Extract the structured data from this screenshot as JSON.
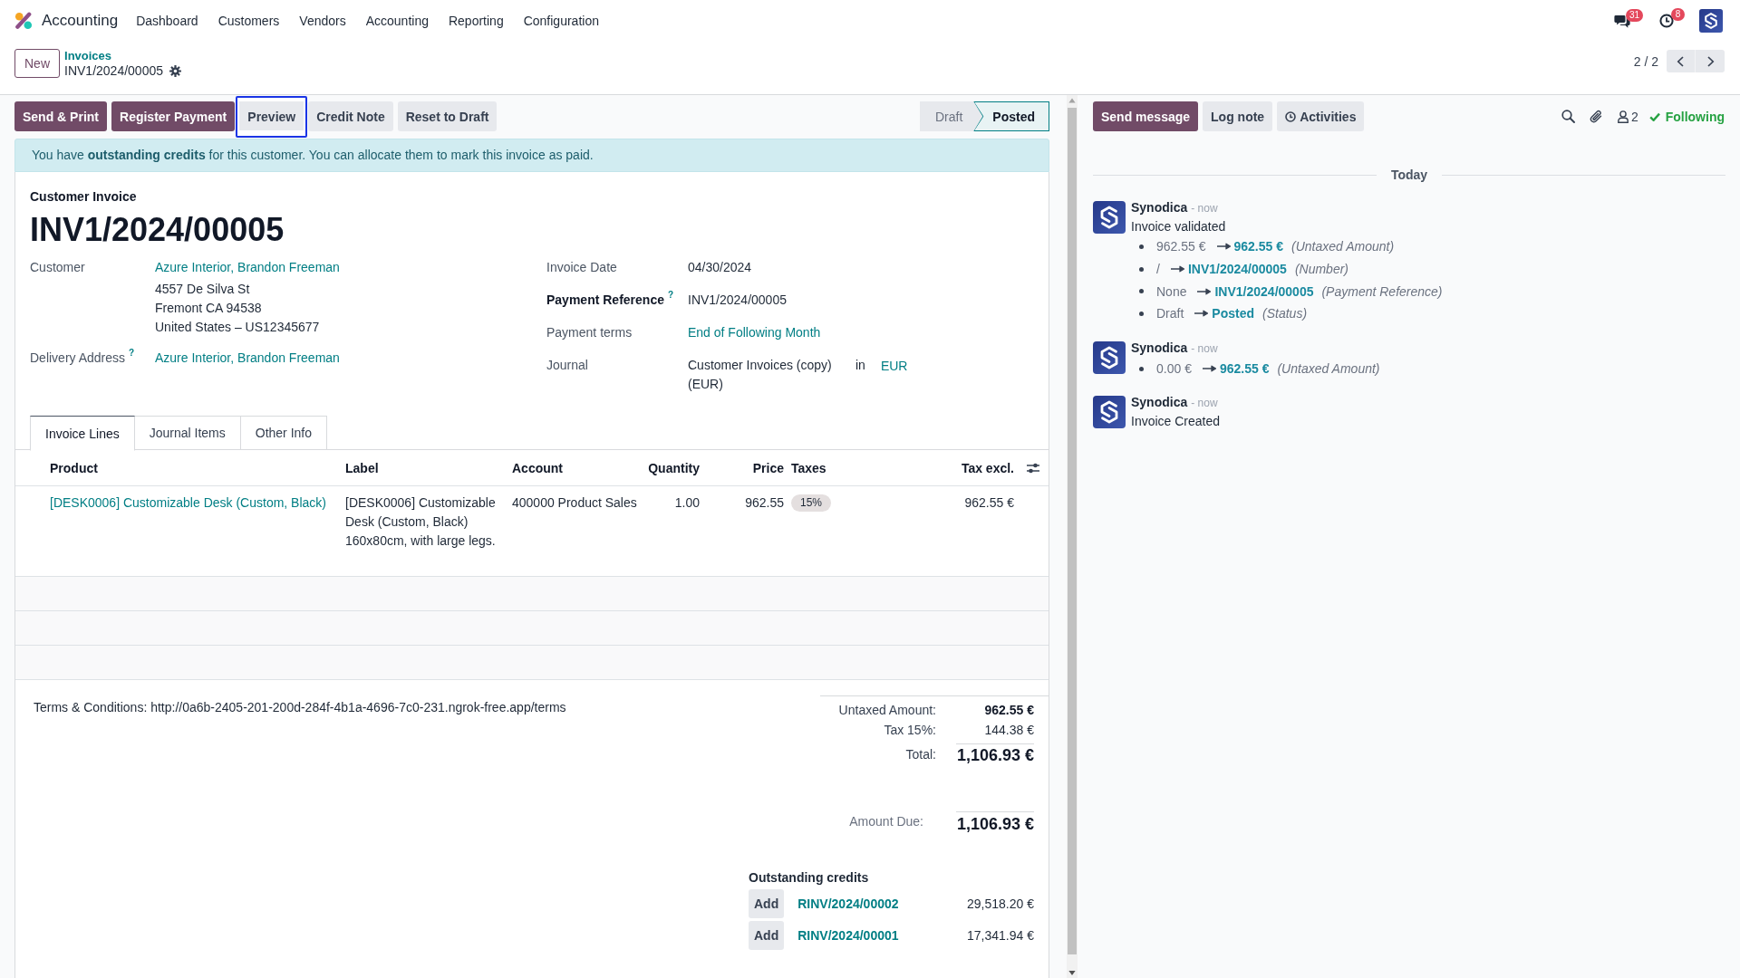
{
  "navbar": {
    "app_name": "Accounting",
    "menu": [
      "Dashboard",
      "Customers",
      "Vendors",
      "Accounting",
      "Reporting",
      "Configuration"
    ],
    "systray": [
      {
        "kind": "messages",
        "badge": "31"
      },
      {
        "kind": "activities",
        "badge": "8"
      }
    ]
  },
  "control_panel": {
    "new_button": "New",
    "breadcrumb": "Invoices",
    "record_name": "INV1/2024/00005",
    "pager": "2 / 2"
  },
  "action_buttons": [
    {
      "label": "Send & Print",
      "kind": "primary",
      "focused": false
    },
    {
      "label": "Register Payment",
      "kind": "primary",
      "focused": false
    },
    {
      "label": "Preview",
      "kind": "secondary",
      "focused": true
    },
    {
      "label": "Credit Note",
      "kind": "secondary",
      "focused": false
    },
    {
      "label": "Reset to Draft",
      "kind": "secondary",
      "focused": false
    }
  ],
  "status_steps": [
    {
      "label": "Draft",
      "selected": false
    },
    {
      "label": "Posted",
      "selected": true
    }
  ],
  "alert": "You have **outstanding credits** for this customer. You can allocate them to mark this invoice as paid.",
  "form": {
    "subtitle": "Customer Invoice",
    "title": "INV1/2024/00005",
    "left_fields": [
      {
        "label": "Customer",
        "required": false,
        "kind": "partner",
        "value": "Azure Interior, Brandon Freeman",
        "address": [
          "4557 De Silva St",
          "Fremont CA 94538",
          "United States – US12345677"
        ]
      },
      {
        "label": "Delivery Address",
        "help": "?",
        "required": false,
        "kind": "link",
        "value": "Azure Interior, Brandon Freeman"
      }
    ],
    "right_fields": [
      {
        "label": "Invoice Date",
        "required": false,
        "kind": "text",
        "value": "04/30/2024"
      },
      {
        "label": "Payment Reference",
        "help": "?",
        "required": true,
        "kind": "text",
        "value": "INV1/2024/00005"
      },
      {
        "label": "Payment terms",
        "required": false,
        "kind": "link",
        "value": "End of Following Month"
      },
      {
        "label": "Journal",
        "required": false,
        "kind": "journal",
        "value": "Customer Invoices (copy) (EUR)",
        "connector": "in",
        "currency": "EUR"
      }
    ]
  },
  "tabs": [
    {
      "label": "Invoice Lines",
      "selected": true
    },
    {
      "label": "Journal Items",
      "selected": false
    },
    {
      "label": "Other Info",
      "selected": false
    }
  ],
  "lines_table": {
    "columns": [
      "Product",
      "Label",
      "Account",
      "Quantity",
      "Price",
      "Taxes",
      "Tax excl."
    ],
    "rows": [
      {
        "product": "[DESK0006] Customizable Desk (Custom, Black)",
        "label": "[DESK0006] Customizable Desk (Custom, Black) 160x80cm, with large legs.",
        "account": "400000 Product Sales",
        "quantity": "1.00",
        "price": "962.55",
        "taxes": [
          "15%"
        ],
        "subtotal": "962.55 €"
      }
    ]
  },
  "terms": "Terms & Conditions: http://0a6b-2405-201-200d-284f-4b1a-4696-7c0-231.ngrok-free.app/terms",
  "totals": [
    {
      "label": "Untaxed Amount:",
      "value": "962.55 €",
      "kind": "untaxed"
    },
    {
      "label": "Tax 15%:",
      "value": "144.38 €",
      "kind": "tax"
    },
    {
      "label": "Total:",
      "value": "1,106.93 €",
      "kind": "total"
    }
  ],
  "amount_due": {
    "label": "Amount Due:",
    "value": "1,106.93 €"
  },
  "outstanding_credits": {
    "title": "Outstanding credits",
    "lines": [
      {
        "action": "Add",
        "reference": "RINV/2024/00002",
        "amount": "29,518.20 €"
      },
      {
        "action": "Add",
        "reference": "RINV/2024/00001",
        "amount": "17,341.94 €"
      }
    ]
  },
  "chatter": {
    "buttons": [
      {
        "label": "Send message",
        "kind": "primary"
      },
      {
        "label": "Log note",
        "kind": "secondary"
      },
      {
        "label": "Activities",
        "kind": "activities"
      }
    ],
    "followers_count": "2",
    "follow_status": "Following",
    "date_separator": "Today",
    "messages": [
      {
        "author": "Synodica",
        "time": "- now",
        "body": "Invoice validated",
        "changes": [
          {
            "old": "962.55 €",
            "new": "962.55 €",
            "field": "(Untaxed Amount)"
          },
          {
            "old": "/",
            "new": "INV1/2024/00005",
            "field": "(Number)"
          },
          {
            "old": "None",
            "new": "INV1/2024/00005",
            "field": "(Payment Reference)"
          },
          {
            "old": "Draft",
            "new": "Posted",
            "field": "(Status)"
          }
        ]
      },
      {
        "author": "Synodica",
        "time": "- now",
        "changes": [
          {
            "old": "0.00 €",
            "new": "962.55 €",
            "field": "(Untaxed Amount)"
          }
        ]
      },
      {
        "author": "Synodica",
        "time": "- now",
        "body": "Invoice Created"
      }
    ]
  }
}
